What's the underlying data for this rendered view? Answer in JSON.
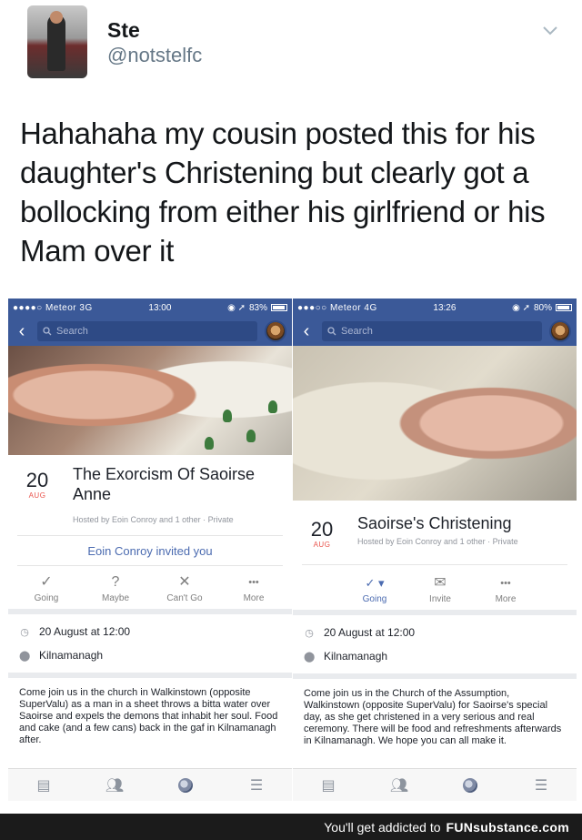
{
  "tweet": {
    "name": "Ste",
    "handle": "@notstelfc",
    "text": "Hahahaha my cousin posted this for his daughter's Christening but clearly got a bollocking from either his girlfriend or his Mam over it"
  },
  "left_phone": {
    "status": {
      "carrier": "●●●●○ Meteor 3G",
      "time": "13:00",
      "battery": "83%",
      "battery_level": 0.83
    },
    "search_placeholder": "Search",
    "date_day": "20",
    "date_month": "AUG",
    "title": "The Exorcism Of Saoirse Anne",
    "hosted": "Hosted by Eoin Conroy and 1 other · Private",
    "invited": "Eoin Conroy invited you",
    "actions": [
      {
        "label": "Going",
        "icon": "✓"
      },
      {
        "label": "Maybe",
        "icon": "?"
      },
      {
        "label": "Can't Go",
        "icon": "✕"
      },
      {
        "label": "More",
        "icon": "•••"
      }
    ],
    "when": "20 August at 12:00",
    "where": "Kilnamanagh",
    "description": "Come join us in the church in Walkinstown (opposite SuperValu) as a man in a sheet throws a bitta water over Saoirse and expels the demons that inhabit her soul. Food and cake (and a few cans) back in the gaf in Kilnamanagh after."
  },
  "right_phone": {
    "status": {
      "carrier": "●●●○○ Meteor 4G",
      "time": "13:26",
      "battery": "80%",
      "battery_level": 0.8
    },
    "search_placeholder": "Search",
    "date_day": "20",
    "date_month": "AUG",
    "title": "Saoirse's Christening",
    "hosted": "Hosted by Eoin Conroy and 1 other · Private",
    "actions": [
      {
        "label": "Going",
        "icon": "✓ ▾"
      },
      {
        "label": "Invite",
        "icon": "✉"
      },
      {
        "label": "More",
        "icon": "•••"
      }
    ],
    "when": "20 August at 12:00",
    "where": "Kilnamanagh",
    "description": "Come join us in the Church of the Assumption, Walkinstown (opposite SuperValu) for Saoirse's special day, as she get christened in a very serious and real ceremony. There will be food and refreshments afterwards in Kilnamanagh. We hope you can all make it."
  },
  "footer": {
    "text": "You'll get addicted to",
    "brand": "FUNsubstance.com"
  }
}
